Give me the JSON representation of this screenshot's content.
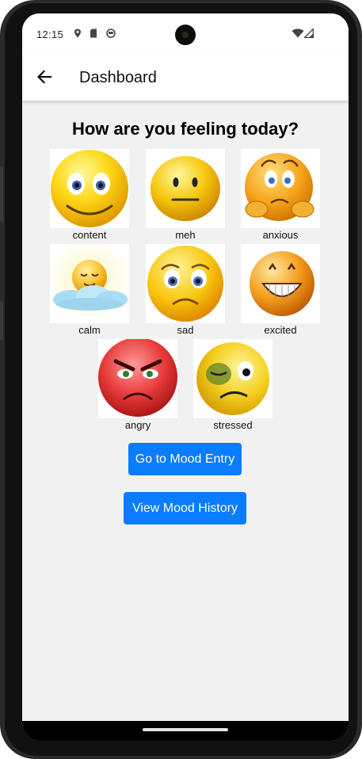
{
  "status_bar": {
    "time": "12:15",
    "icons": [
      "location-icon",
      "sim-card-icon",
      "privacy-icon",
      "wifi-icon",
      "signal-icon"
    ]
  },
  "app_bar": {
    "title": "Dashboard",
    "back_icon": "arrow-left-icon"
  },
  "main": {
    "heading": "How are you feeling today?",
    "moods": [
      {
        "label": "content",
        "icon": "content-face-icon"
      },
      {
        "label": "meh",
        "icon": "meh-face-icon"
      },
      {
        "label": "anxious",
        "icon": "anxious-face-icon"
      },
      {
        "label": "calm",
        "icon": "calm-face-icon"
      },
      {
        "label": "sad",
        "icon": "sad-face-icon"
      },
      {
        "label": "excited",
        "icon": "excited-face-icon"
      },
      {
        "label": "angry",
        "icon": "angry-face-icon"
      },
      {
        "label": "stressed",
        "icon": "stressed-face-icon"
      }
    ],
    "mood_entry_button": "Go to Mood Entry",
    "mood_history_button": "View Mood History"
  },
  "colors": {
    "accent": "#0a7cff",
    "background": "#f1f1f1"
  }
}
